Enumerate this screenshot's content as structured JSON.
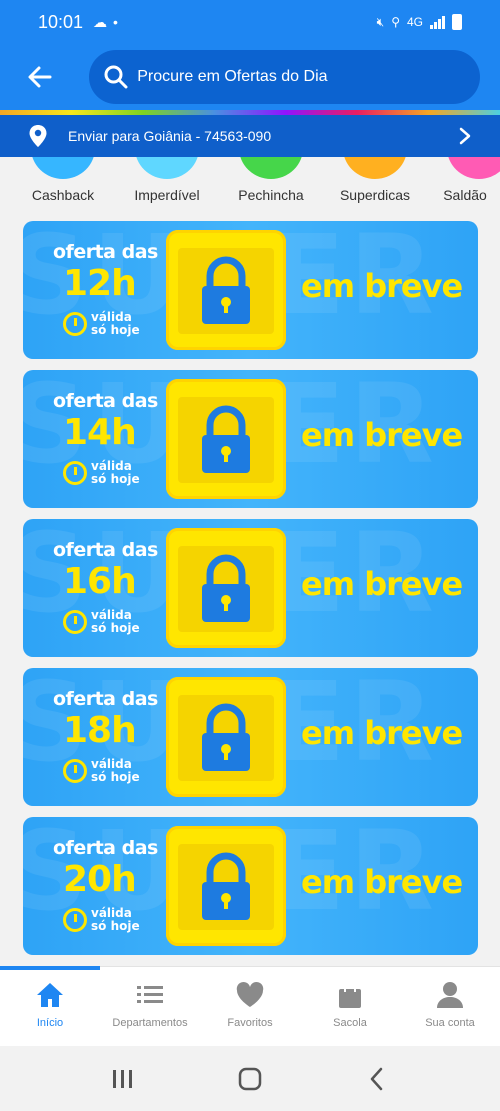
{
  "status_bar": {
    "time": "10:01",
    "network": "4G"
  },
  "header": {
    "search_placeholder": "Procure em Ofertas do Dia"
  },
  "address": {
    "text": "Enviar para Goiânia - 74563-090"
  },
  "categories": [
    {
      "label": "Cashback",
      "color": "#36b6ff"
    },
    {
      "label": "Imperdível",
      "color": "#5fd7ff"
    },
    {
      "label": "Pechincha",
      "color": "#46d64a"
    },
    {
      "label": "Superdicas",
      "color": "#ffb020"
    },
    {
      "label": "Saldão",
      "color": "#ff5bb4"
    }
  ],
  "banners": [
    {
      "title": "oferta das",
      "hour": "12h",
      "validity": "válida só hoje",
      "status": "em breve"
    },
    {
      "title": "oferta das",
      "hour": "14h",
      "validity": "válida só hoje",
      "status": "em breve"
    },
    {
      "title": "oferta das",
      "hour": "16h",
      "validity": "válida só hoje",
      "status": "em breve"
    },
    {
      "title": "oferta das",
      "hour": "18h",
      "validity": "válida só hoje",
      "status": "em breve"
    },
    {
      "title": "oferta das",
      "hour": "20h",
      "validity": "válida só hoje",
      "status": "em breve"
    }
  ],
  "bottom_nav": [
    {
      "label": "Início",
      "icon": "home-icon",
      "active": true
    },
    {
      "label": "Departamentos",
      "icon": "list-icon",
      "active": false
    },
    {
      "label": "Favoritos",
      "icon": "heart-icon",
      "active": false
    },
    {
      "label": "Sacola",
      "icon": "bag-icon",
      "active": false
    },
    {
      "label": "Sua conta",
      "icon": "user-icon",
      "active": false
    }
  ],
  "colors": {
    "brand_blue": "#1e86f2",
    "dark_blue": "#0c63d0",
    "yellow": "#ffe600"
  }
}
